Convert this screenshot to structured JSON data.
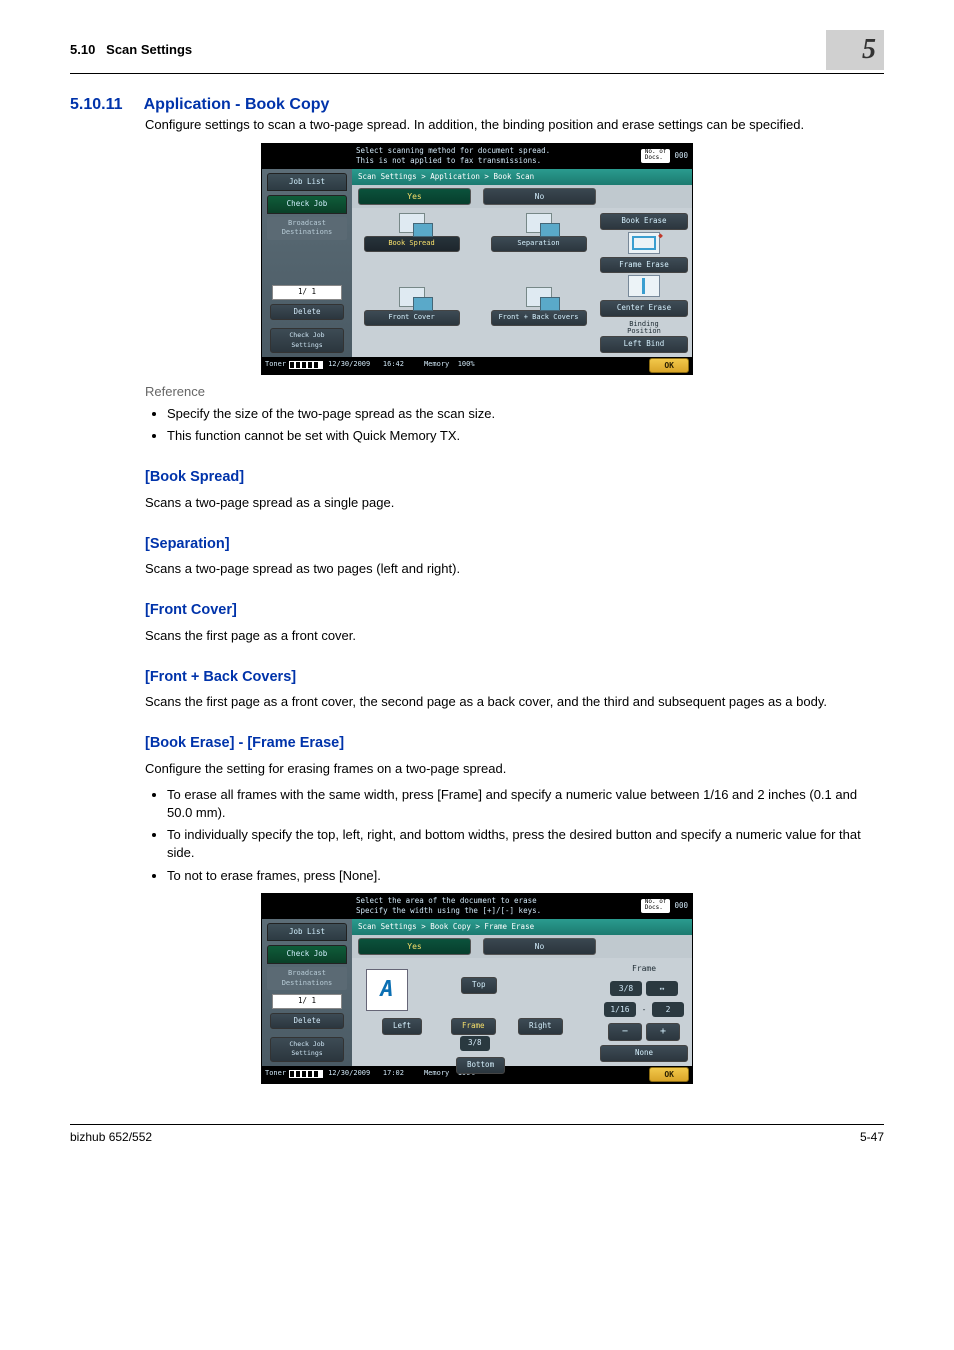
{
  "header": {
    "section_num_small": "5.10",
    "section_title_small": "Scan Settings",
    "chapter_badge": "5"
  },
  "section": {
    "num": "5.10.11",
    "title": "Application - Book Copy"
  },
  "intro": "Configure settings to scan a two-page spread. In addition, the binding position and erase settings can be specified.",
  "reference_label": "Reference",
  "reference_items": [
    "Specify the size of the two-page spread as the scan size.",
    "This function cannot be set with Quick Memory TX."
  ],
  "sub": {
    "book_spread": {
      "h": "[Book Spread]",
      "t": "Scans a two-page spread as a single page."
    },
    "separation": {
      "h": "[Separation]",
      "t": "Scans a two-page spread as two pages (left and right)."
    },
    "front_cover": {
      "h": "[Front Cover]",
      "t": "Scans the first page as a front cover."
    },
    "front_back": {
      "h": "[Front + Back Covers]",
      "t": "Scans the first page as a front cover, the second page as a back cover, and the third and subsequent pages as a body."
    },
    "book_erase": {
      "h": "[Book Erase] - [Frame Erase]",
      "t": "Configure the setting for erasing frames on a two-page spread."
    }
  },
  "erase_items": [
    "To erase all frames with the same width, press [Frame] and specify a numeric value between 1/16 and 2 inches (0.1 and 50.0 mm).",
    "To individually specify the top, left, right, and bottom widths, press the desired button and specify a numeric value for that side.",
    "To not to erase frames, press [None]."
  ],
  "footer": {
    "model": "bizhub 652/552",
    "page": "5-47"
  },
  "screen1": {
    "joblist": "Job List",
    "checkjob": "Check Job",
    "instr": "Select scanning method for document spread.\nThis is not applied to fax transmissions.",
    "docs_label": "No. of\nDocs.",
    "docs_val": "000",
    "breadcrumb": "Scan Settings > Application > Book Scan",
    "yes": "Yes",
    "no": "No",
    "broadcast": "Broadcast\nDestinations",
    "opts": {
      "bs": "Book Spread",
      "sep": "Separation",
      "fc": "Front Cover",
      "fbc": "Front + Back Covers"
    },
    "side": {
      "berase": "Book Erase",
      "ferase": "Frame Erase",
      "cerase": "Center Erase",
      "bpos": "Binding\nPosition",
      "bpos_val": "Left Bind"
    },
    "page_ind": "1/  1",
    "del": "Delete",
    "chk": "Check Job\nSettings",
    "date": "12/30/2009",
    "time": "16:42",
    "mem": "Memory",
    "mem_val": "100%",
    "toner": "Toner",
    "ok": "OK"
  },
  "screen2": {
    "instr": "Select the area of the document to erase\nSpecify the width using the [+]/[-] keys.",
    "breadcrumb": "Scan Settings > Book Copy > Frame Erase",
    "top": "Top",
    "left": "Left",
    "frame": "Frame",
    "right": "Right",
    "bottom": "Bottom",
    "val": "3/8",
    "side_label": "Frame",
    "v1": "3/8",
    "v2": "↔",
    "v3": "1/16",
    "v4": "-",
    "v5": "2",
    "minus": "−",
    "plus": "+",
    "none": "None",
    "time": "17:02"
  }
}
